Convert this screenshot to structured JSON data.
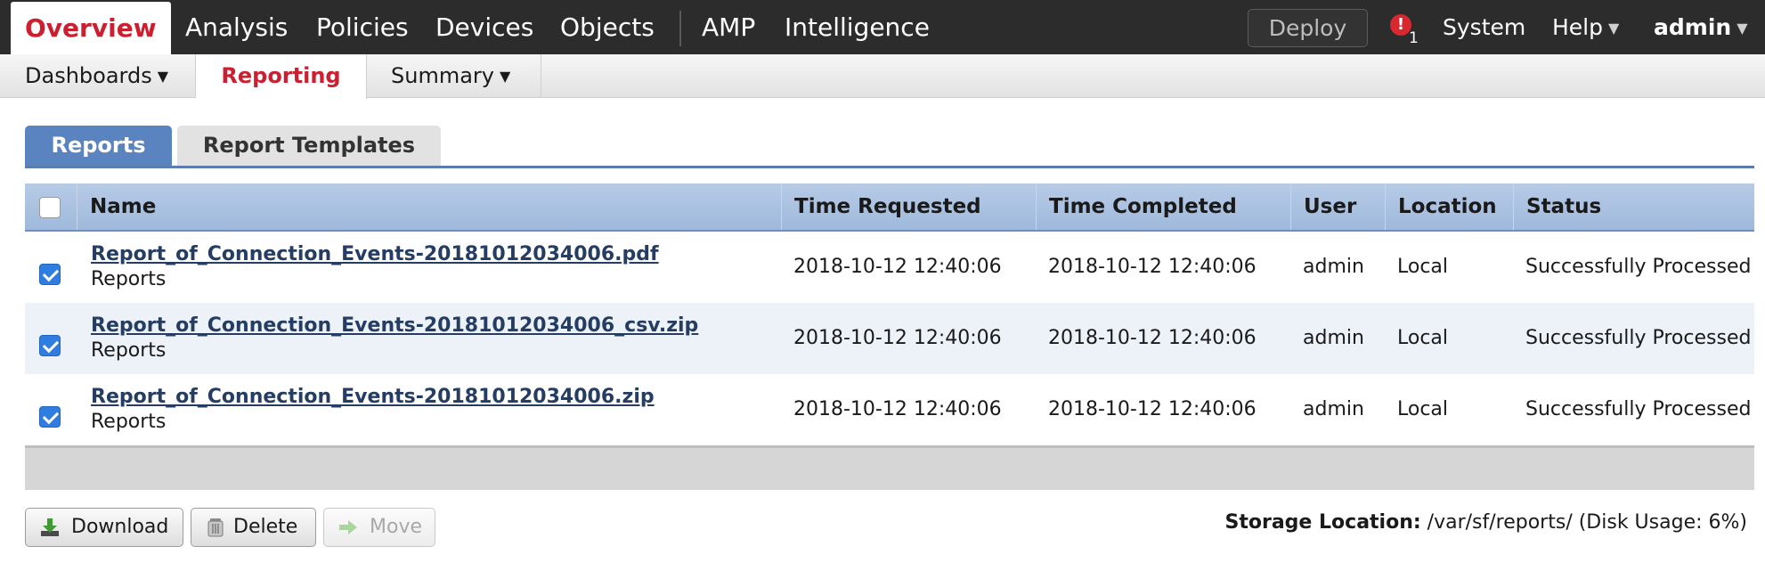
{
  "topnav": {
    "items": [
      "Overview",
      "Analysis",
      "Policies",
      "Devices",
      "Objects",
      "AMP",
      "Intelligence"
    ],
    "deploy_label": "Deploy",
    "alert_count": "1",
    "system_label": "System",
    "help_label": "Help",
    "user_label": "admin"
  },
  "subnav": {
    "items": [
      "Dashboards",
      "Reporting",
      "Summary"
    ]
  },
  "tabs": {
    "reports": "Reports",
    "templates": "Report Templates"
  },
  "table": {
    "columns": [
      "Name",
      "Time Requested",
      "Time Completed",
      "User",
      "Location",
      "Status"
    ],
    "rows": [
      {
        "name": "Report_of_Connection_Events-20181012034006.pdf",
        "folder": "Reports",
        "time_requested": "2018-10-12 12:40:06",
        "time_completed": "2018-10-12 12:40:06",
        "user": "admin",
        "location": "Local",
        "status": "Successfully Processed"
      },
      {
        "name": "Report_of_Connection_Events-20181012034006_csv.zip",
        "folder": "Reports",
        "time_requested": "2018-10-12 12:40:06",
        "time_completed": "2018-10-12 12:40:06",
        "user": "admin",
        "location": "Local",
        "status": "Successfully Processed"
      },
      {
        "name": "Report_of_Connection_Events-20181012034006.zip",
        "folder": "Reports",
        "time_requested": "2018-10-12 12:40:06",
        "time_completed": "2018-10-12 12:40:06",
        "user": "admin",
        "location": "Local",
        "status": "Successfully Processed"
      }
    ]
  },
  "actions": {
    "download": "Download",
    "delete": "Delete",
    "move": "Move"
  },
  "storage": {
    "label": "Storage Location:",
    "value": "/var/sf/reports/ (Disk Usage: 6%)"
  },
  "colors": {
    "brand_red": "#cc1f2f",
    "tab_blue": "#5a84bf",
    "checkbox_blue": "#2f7de1",
    "link_navy": "#253d63"
  }
}
